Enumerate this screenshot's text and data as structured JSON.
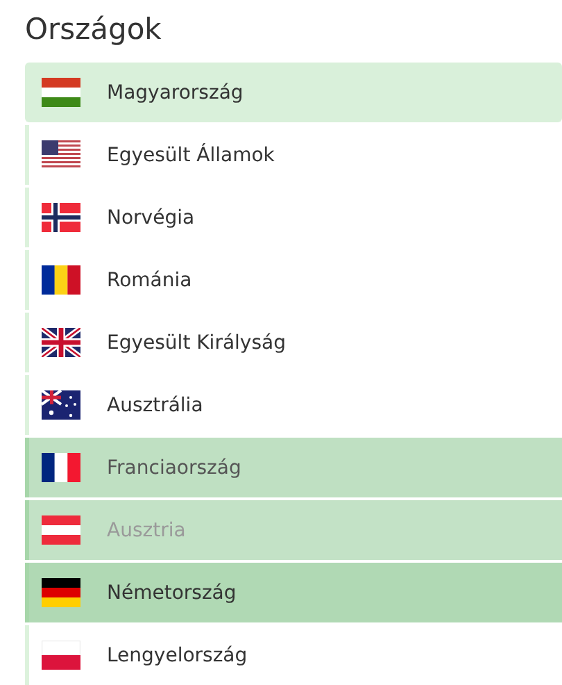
{
  "title": "Országok",
  "countries": [
    {
      "name": "Magyarország",
      "highlighted": true,
      "selected": false,
      "hovered": false,
      "disabled": false
    },
    {
      "name": "Egyesült Államok",
      "highlighted": false,
      "selected": false,
      "hovered": false,
      "disabled": false
    },
    {
      "name": "Norvégia",
      "highlighted": false,
      "selected": false,
      "hovered": false,
      "disabled": false
    },
    {
      "name": "Románia",
      "highlighted": false,
      "selected": false,
      "hovered": false,
      "disabled": false
    },
    {
      "name": "Egyesült Királyság",
      "highlighted": false,
      "selected": false,
      "hovered": false,
      "disabled": false
    },
    {
      "name": "Ausztrália",
      "highlighted": false,
      "selected": false,
      "hovered": false,
      "disabled": false
    },
    {
      "name": "Franciaország",
      "highlighted": false,
      "selected": true,
      "hovered": true,
      "disabled": false
    },
    {
      "name": "Ausztria",
      "highlighted": false,
      "selected": true,
      "hovered": false,
      "disabled": true
    },
    {
      "name": "Németország",
      "highlighted": false,
      "selected": true,
      "hovered": false,
      "disabled": false
    },
    {
      "name": "Lengyelország",
      "highlighted": false,
      "selected": false,
      "hovered": false,
      "disabled": false
    }
  ]
}
